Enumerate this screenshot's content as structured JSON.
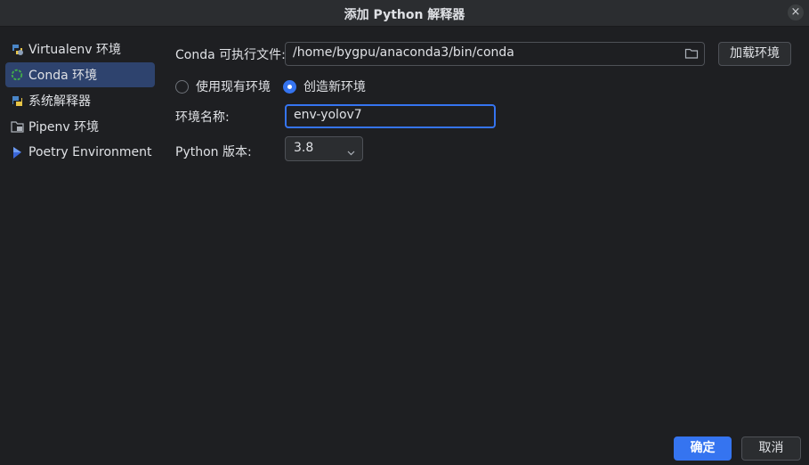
{
  "window": {
    "title": "添加 Python 解释器",
    "close_label": "×"
  },
  "sidebar": {
    "items": [
      {
        "label": "Virtualenv 环境",
        "icon": "virtualenv-icon"
      },
      {
        "label": "Conda 环境",
        "icon": "conda-icon",
        "selected": true
      },
      {
        "label": "系统解释器",
        "icon": "python-icon"
      },
      {
        "label": "Pipenv 环境",
        "icon": "pipenv-icon"
      },
      {
        "label": "Poetry Environment",
        "icon": "poetry-icon"
      }
    ]
  },
  "form": {
    "conda_label": "Conda 可执行文件:",
    "conda_path": "/home/bygpu/anaconda3/bin/conda",
    "load_env_label": "加载环境",
    "radio_existing": "使用现有环境",
    "radio_new": "创造新环境",
    "selected_radio": "new",
    "env_name_label": "环境名称:",
    "env_name_value": "env-yolov7",
    "python_version_label": "Python 版本:",
    "python_version_value": "3.8"
  },
  "footer": {
    "ok_label": "确定",
    "cancel_label": "取消"
  },
  "colors": {
    "accent": "#3574f0",
    "selection": "#2e436e",
    "background": "#1e1f22"
  }
}
